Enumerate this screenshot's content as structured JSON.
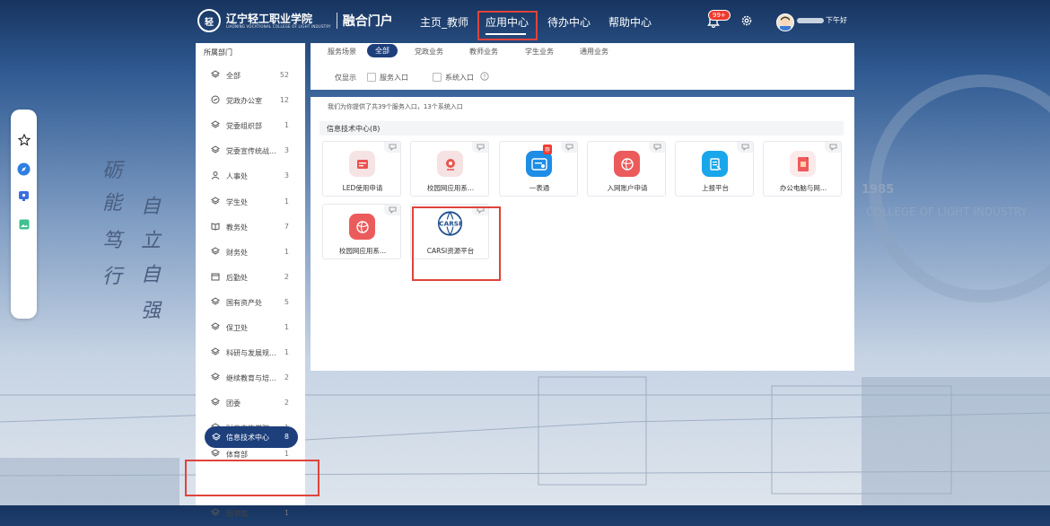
{
  "header": {
    "school_name": "辽宁轻工职业学院",
    "school_name_en": "LIAONING VOCATIONAL COLLEGE OF LIGHT INDUSTRY",
    "portal_name": "融合门户",
    "nav": [
      {
        "label": "主页_教师"
      },
      {
        "label": "应用中心",
        "active": true
      },
      {
        "label": "待办中心"
      },
      {
        "label": "帮助中心"
      }
    ],
    "notification_badge": "99+",
    "username": "下午好"
  },
  "background": {
    "calligraphy": [
      "砺",
      "能",
      "笃",
      "行",
      "自",
      "立",
      "自",
      "强"
    ],
    "motto_en": "COLLEGE OF LIGHT INDUSTRY",
    "year": "1985"
  },
  "dock": {
    "icons": [
      "star-icon",
      "compass-icon",
      "monitor-icon",
      "image-icon"
    ]
  },
  "sidebar": {
    "title": "所属部门",
    "items": [
      {
        "label": "全部",
        "count": "52",
        "icon": "layers-icon"
      },
      {
        "label": "党政办公室",
        "count": "12",
        "icon": "party-icon"
      },
      {
        "label": "党委组织部",
        "count": "1",
        "icon": "layers-icon"
      },
      {
        "label": "党委宣传统战...",
        "count": "3",
        "icon": "layers-icon"
      },
      {
        "label": "人事处",
        "count": "3",
        "icon": "user-icon"
      },
      {
        "label": "学生处",
        "count": "1",
        "icon": "layers-icon"
      },
      {
        "label": "教务处",
        "count": "7",
        "icon": "book-icon"
      },
      {
        "label": "财务处",
        "count": "1",
        "icon": "layers-icon"
      },
      {
        "label": "后勤处",
        "count": "2",
        "icon": "calendar-icon"
      },
      {
        "label": "国有资产处",
        "count": "5",
        "icon": "layers-icon"
      },
      {
        "label": "保卫处",
        "count": "1",
        "icon": "layers-icon"
      },
      {
        "label": "科研与发展规...",
        "count": "1",
        "icon": "layers-icon"
      },
      {
        "label": "继续教育与培...",
        "count": "2",
        "icon": "layers-icon"
      },
      {
        "label": "团委",
        "count": "2",
        "icon": "layers-icon"
      },
      {
        "label": "财商文旅学院",
        "count": "1",
        "icon": "layers-icon"
      },
      {
        "label": "体育部",
        "count": "1",
        "icon": "layers-icon"
      },
      {
        "label": "信息技术中心",
        "count": "8",
        "icon": "layers-icon",
        "active": true
      },
      {
        "label": "图书馆",
        "count": "1",
        "icon": "layers-icon"
      }
    ]
  },
  "filter": {
    "scene_label": "服务场景",
    "chips": [
      "全部",
      "党政业务",
      "教师业务",
      "学生业务",
      "通用业务"
    ],
    "show_only_label": "仅显示",
    "options": [
      "服务入口",
      "系统入口"
    ]
  },
  "content": {
    "summary": "我们为你提供了共39个服务入口，13个系统入口",
    "group_title": "信息技术中心(8)",
    "recommend_tag": "荐",
    "apps": [
      {
        "label": "LED使用申请",
        "icon": "led-apply-icon",
        "color": "#f3e4e4"
      },
      {
        "label": "校园网应用系...",
        "icon": "campus-net-icon",
        "color": "#f6e2e2"
      },
      {
        "label": "一表通",
        "icon": "form-icon",
        "color": "#1e8de6"
      },
      {
        "label": "入网账户申请",
        "icon": "globe-icon",
        "color": "#ec5b5b"
      },
      {
        "label": "上报平台",
        "icon": "report-icon",
        "color": "#1aa6ea"
      },
      {
        "label": "办公电脑与网...",
        "icon": "office-pc-icon",
        "color": "#f6e2e2"
      },
      {
        "label": "校园网应用系...",
        "icon": "globe-icon",
        "color": "#ec5b5b"
      },
      {
        "label": "CARSI资源平台",
        "icon": "carsi-logo-icon",
        "color": "#ffffff"
      }
    ]
  },
  "colors": {
    "primary": "#1d3f7c",
    "highlight_box": "#e0433c",
    "badge": "#ee3b2f"
  }
}
